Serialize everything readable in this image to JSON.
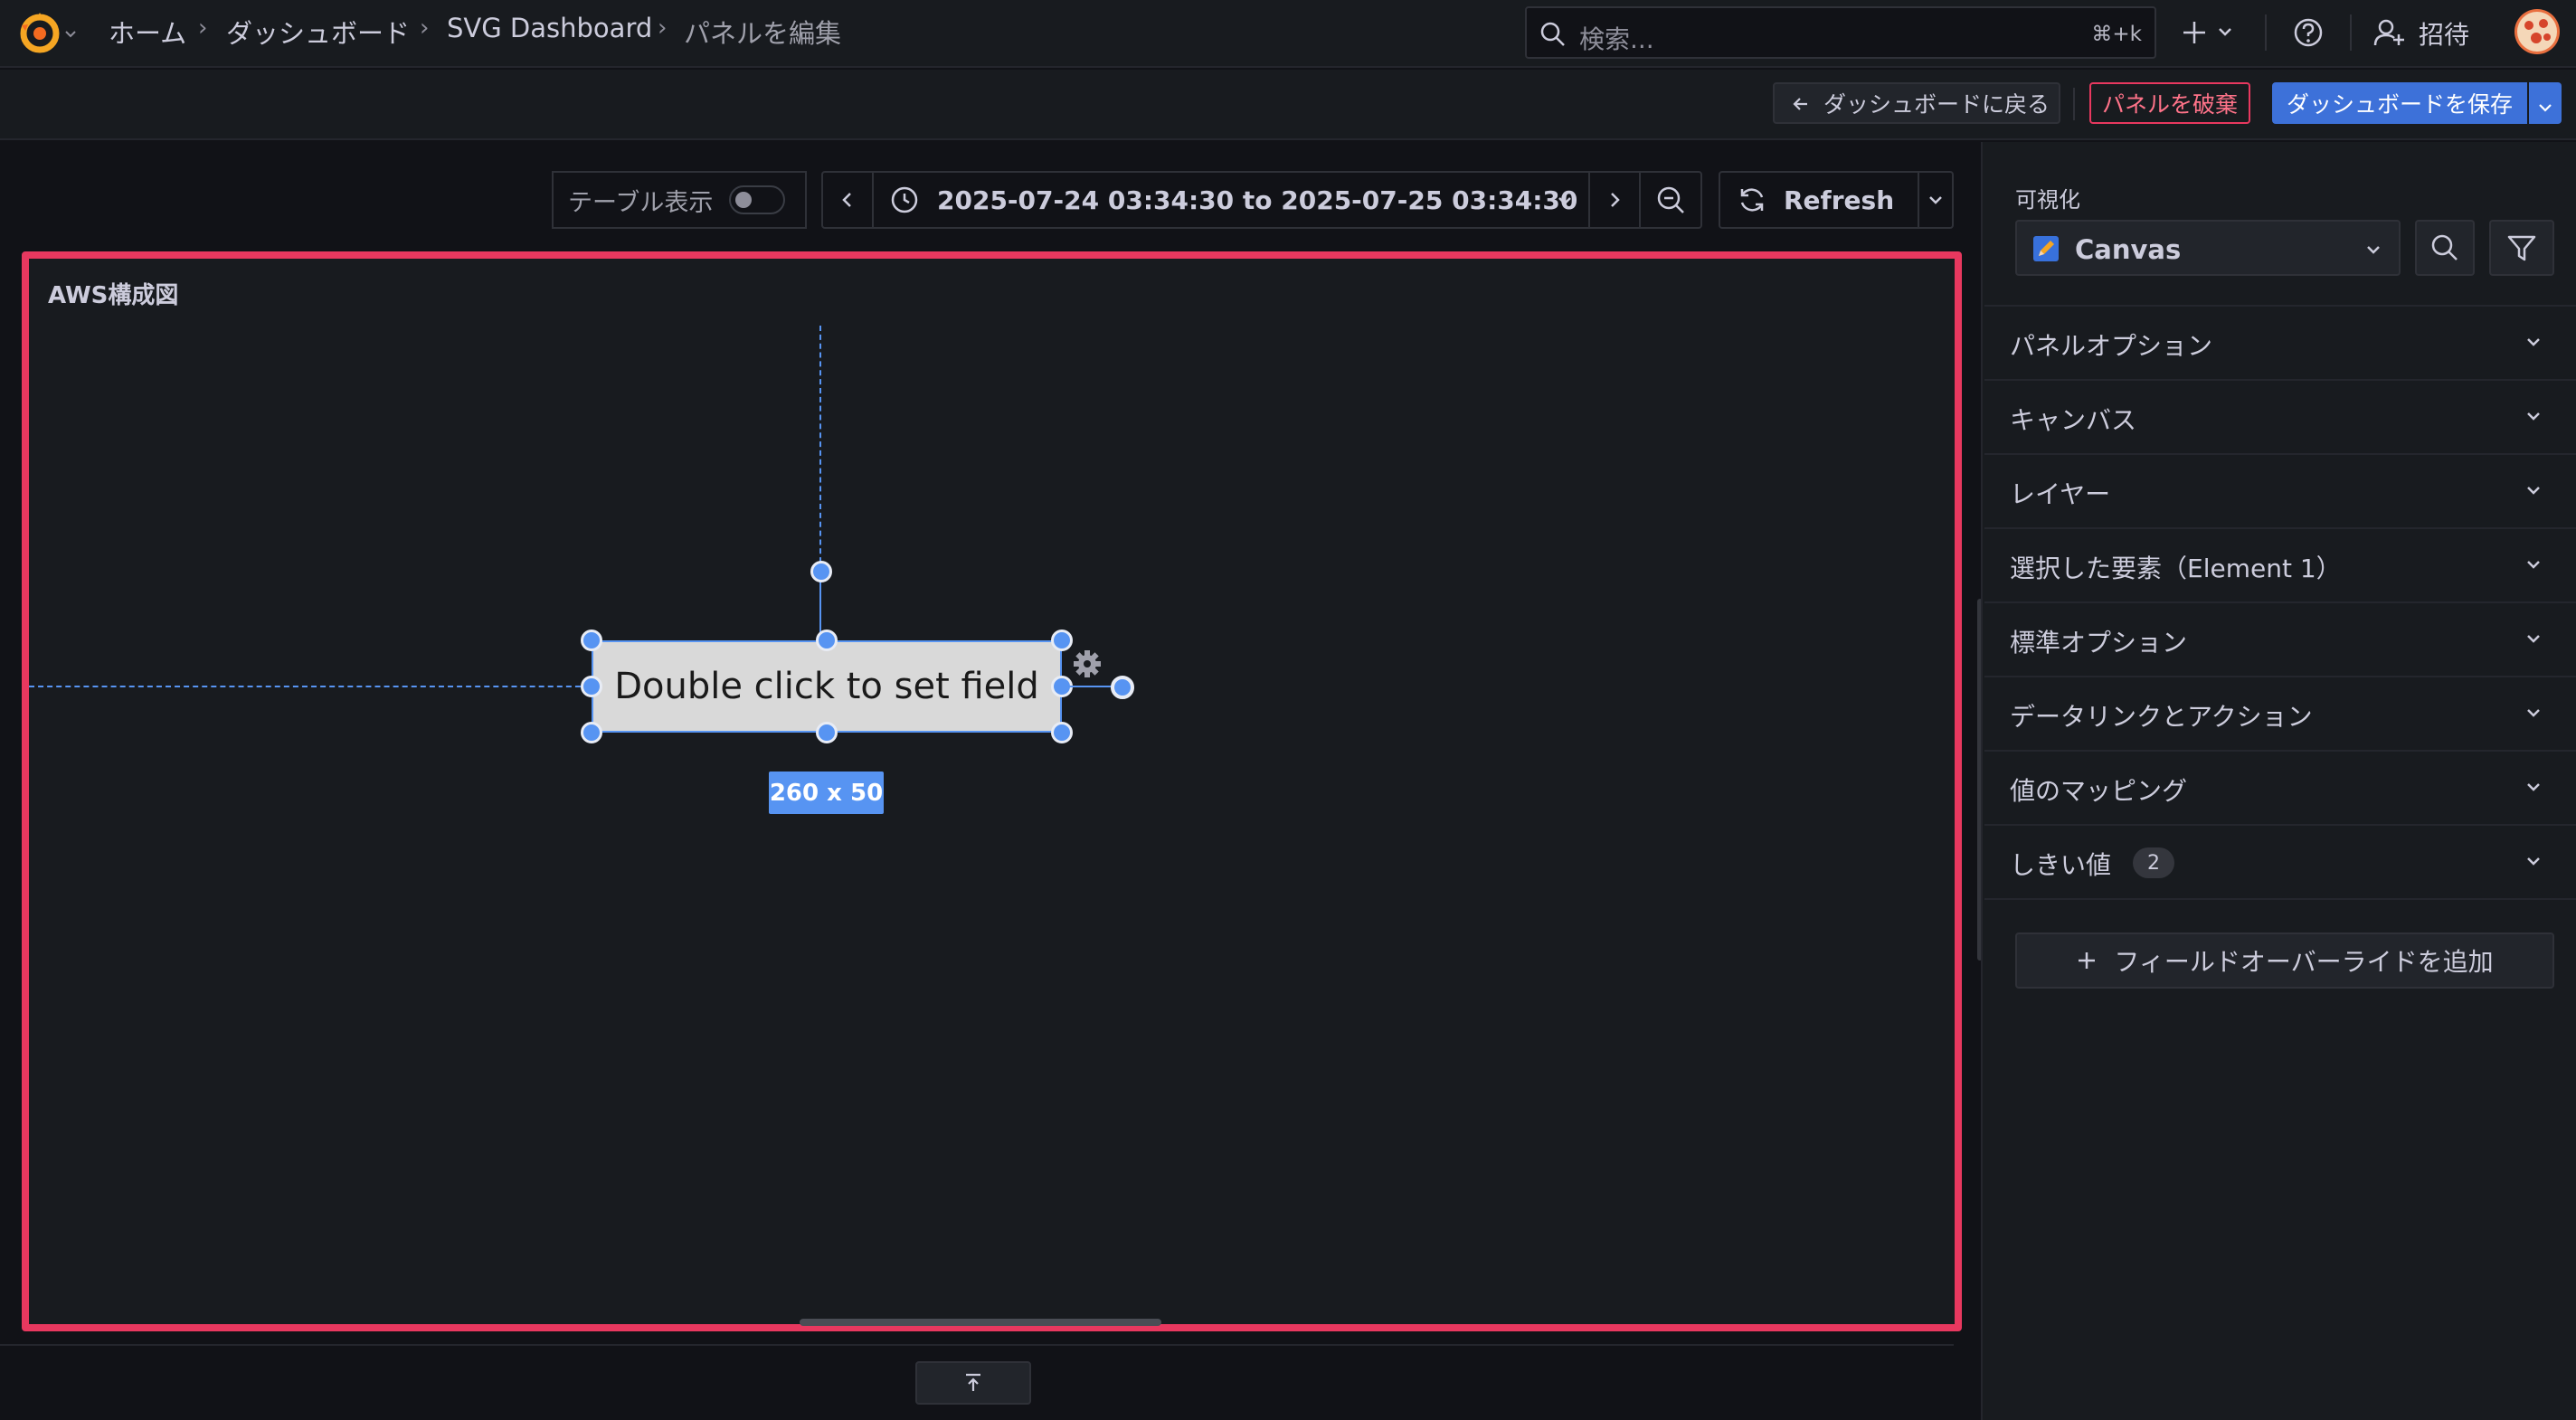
{
  "breadcrumbs": [
    "ホーム",
    "ダッシュボード",
    "SVG Dashboard",
    "パネルを編集"
  ],
  "search": {
    "placeholder": "検索...",
    "shortcut": "⌘+k"
  },
  "nav": {
    "invite_label": "招待"
  },
  "subbar": {
    "back_label": "ダッシュボードに戻る",
    "discard_label": "パネルを破棄",
    "save_label": "ダッシュボードを保存"
  },
  "toolbar": {
    "table_view_label": "テーブル表示",
    "table_view_on": false,
    "time_range": "2025-07-24 03:34:30 to 2025-07-25 03:34:30",
    "refresh_label": "Refresh"
  },
  "panel": {
    "title": "AWS構成図",
    "element_text": "Double click to set field",
    "element_size": "260 x 50"
  },
  "sidebar": {
    "visualization_label": "可視化",
    "visualization_value": "Canvas",
    "sections": [
      {
        "label": "パネルオプション"
      },
      {
        "label": "キャンバス"
      },
      {
        "label": "レイヤー"
      },
      {
        "label": "選択した要素（Element 1）"
      },
      {
        "label": "標準オプション"
      },
      {
        "label": "データリンクとアクション"
      },
      {
        "label": "値のマッピング"
      },
      {
        "label": "しきい値",
        "badge": "2"
      }
    ],
    "add_override_label": "フィールドオーバーライドを追加"
  },
  "colors": {
    "accent": "#5794f2",
    "danger": "#e8385f",
    "primary_button": "#3d71d9",
    "background": "#111217",
    "surface": "#181b1f"
  }
}
